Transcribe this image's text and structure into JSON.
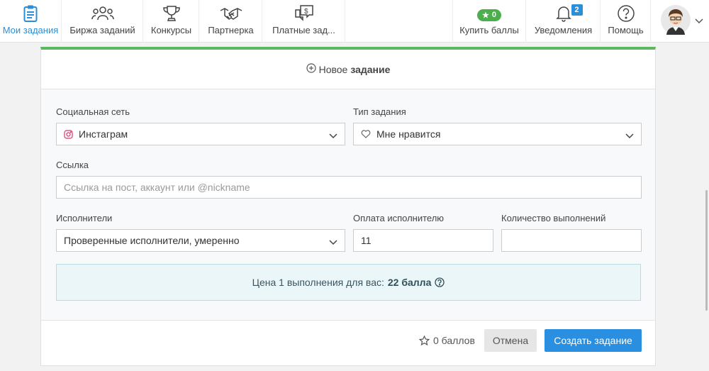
{
  "nav": {
    "my_tasks": "Мои задания",
    "exchange": "Биржа заданий",
    "contests": "Конкурсы",
    "partner": "Партнерка",
    "paid": "Платные зад...",
    "buy_points": "Купить баллы",
    "stars_count": "0",
    "notifications": "Уведомления",
    "notifications_count": "2",
    "help": "Помощь"
  },
  "card": {
    "header_prefix": "Новое",
    "header_bold": "задание",
    "social_label": "Социальная сеть",
    "social_value": "Инстаграм",
    "type_label": "Тип задания",
    "type_value": "Мне нравится",
    "link_label": "Ссылка",
    "link_placeholder": "Ссылка на пост, аккаунт или @nickname",
    "performers_label": "Исполнители",
    "performers_value": "Проверенные исполнители, умеренно",
    "payment_label": "Оплата исполнителю",
    "payment_value": "11",
    "count_label": "Количество выполнений",
    "count_value": "",
    "price_prefix": "Цена 1 выполнения для вас:",
    "price_value": "22 балла",
    "balls_text": "0 баллов",
    "cancel": "Отмена",
    "create": "Создать задание"
  },
  "colors": {
    "accent": "#2a8fd8",
    "green": "#5cb85c",
    "create_button": "#2a8fe0"
  }
}
